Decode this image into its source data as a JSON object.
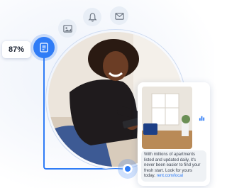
{
  "progress": {
    "label": "87%",
    "value": 0.87
  },
  "icons": {
    "document": "document-icon",
    "image": "image-icon",
    "notification": "bell-icon",
    "mail": "mail-icon",
    "chart": "bar-chart-icon"
  },
  "message_card": {
    "text": "With millions of apartments listed and updated daily, it's never been easier to find your fresh start. Look for yours today. ",
    "link_text": "rent.com/local"
  },
  "colors": {
    "accent": "#2f7cf6",
    "icon_bg": "#e8eef6",
    "bubble_bg": "#eff2f5",
    "text": "#1d2433"
  }
}
